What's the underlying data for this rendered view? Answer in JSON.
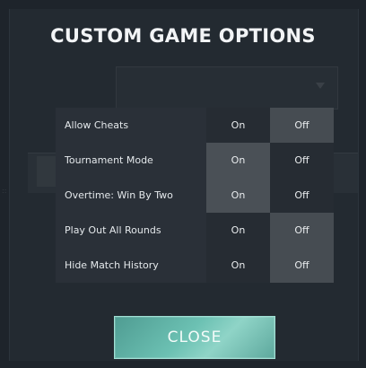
{
  "dialog": {
    "title": "CUSTOM GAME OPTIONS",
    "close_label": "CLOSE"
  },
  "background": {
    "select_text": "",
    "dots": "::"
  },
  "options": [
    {
      "label": "Allow Cheats",
      "on_label": "On",
      "off_label": "Off",
      "selected": "off"
    },
    {
      "label": "Tournament Mode",
      "on_label": "On",
      "off_label": "Off",
      "selected": "on"
    },
    {
      "label": "Overtime: Win By Two",
      "on_label": "On",
      "off_label": "Off",
      "selected": "on"
    },
    {
      "label": "Play Out All Rounds",
      "on_label": "On",
      "off_label": "Off",
      "selected": "off"
    },
    {
      "label": "Hide Match History",
      "on_label": "On",
      "off_label": "Off",
      "selected": "off"
    }
  ],
  "colors": {
    "accent": "#6cc1b3",
    "selected_option": "#464c52"
  }
}
